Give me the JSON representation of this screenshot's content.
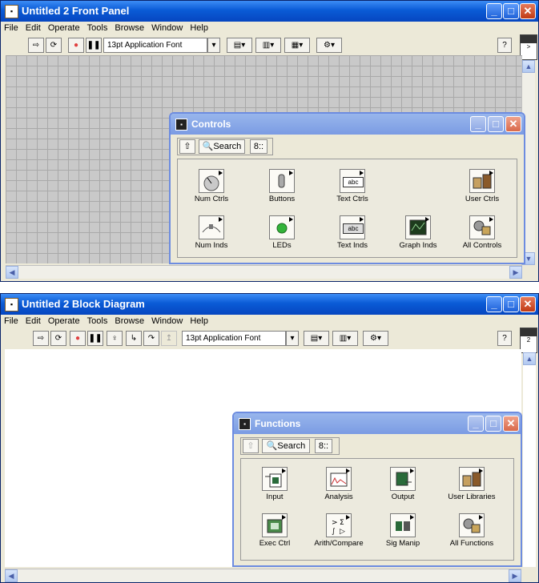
{
  "front_panel": {
    "title": "Untitled 2 Front Panel",
    "menu": [
      "File",
      "Edit",
      "Operate",
      "Tools",
      "Browse",
      "Window",
      "Help"
    ],
    "font_selector": "13pt Application Font",
    "toolbar_icons": [
      "run-arrow",
      "run-continuously",
      "abort",
      "pause",
      "align-objects",
      "distribute-objects",
      "resize-objects",
      "reorder"
    ],
    "window_buttons": [
      "minimize",
      "maximize",
      "close"
    ],
    "help_glyph": "?",
    "context_help": ">"
  },
  "controls_palette": {
    "title": "Controls",
    "toolbar": {
      "up_glyph": "⇧",
      "search_label": "Search",
      "options_glyph": "8::"
    },
    "items": [
      {
        "label": "Num Ctrls",
        "icon": "knob-icon"
      },
      {
        "label": "Buttons",
        "icon": "toggle-switch-icon"
      },
      {
        "label": "Text Ctrls",
        "icon": "text-box-icon",
        "glyph": "abc"
      },
      {
        "label": "User Ctrls",
        "icon": "building-icon"
      },
      {
        "label": "Num Inds",
        "icon": "slider-icon"
      },
      {
        "label": "LEDs",
        "icon": "led-icon"
      },
      {
        "label": "Text Inds",
        "icon": "text-box-icon",
        "glyph": "abc"
      },
      {
        "label": "Graph Inds",
        "icon": "graph-icon"
      },
      {
        "label": "All Controls",
        "icon": "all-controls-icon"
      }
    ]
  },
  "block_diagram": {
    "title": "Untitled 2 Block Diagram",
    "menu": [
      "File",
      "Edit",
      "Operate",
      "Tools",
      "Browse",
      "Window",
      "Help"
    ],
    "font_selector": "13pt Application Font",
    "toolbar_icons": [
      "run-arrow",
      "run-continuously",
      "abort",
      "pause",
      "highlight-execution",
      "step-into",
      "step-over",
      "step-out",
      "align-objects",
      "distribute-objects",
      "reorder"
    ],
    "help_glyph": "?",
    "context_help": "2"
  },
  "functions_palette": {
    "title": "Functions",
    "toolbar": {
      "up_glyph": "⇧",
      "search_label": "Search",
      "options_glyph": "8::"
    },
    "items": [
      {
        "label": "Input",
        "icon": "input-icon"
      },
      {
        "label": "Analysis",
        "icon": "analysis-icon"
      },
      {
        "label": "Output",
        "icon": "output-icon"
      },
      {
        "label": "User Libraries",
        "icon": "building-icon"
      },
      {
        "label": "Exec Ctrl",
        "icon": "exec-ctrl-icon"
      },
      {
        "label": "Arith/Compare",
        "icon": "arith-compare-icon"
      },
      {
        "label": "Sig Manip",
        "icon": "sig-manip-icon"
      },
      {
        "label": "All Functions",
        "icon": "all-functions-icon"
      }
    ]
  },
  "colors": {
    "title_blue": "#0a5bd6",
    "grid_gray": "#c9c9c9",
    "palette_title": "#7b9be3",
    "close_red": "#c13a14"
  }
}
